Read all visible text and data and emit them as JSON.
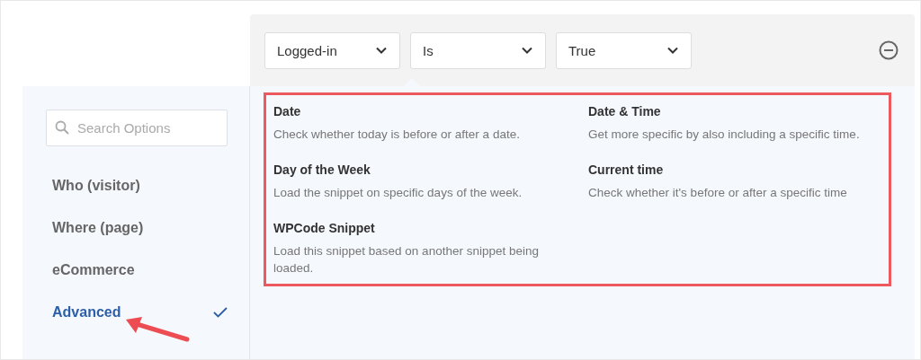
{
  "conditions": [
    {
      "value": "Logged-in"
    },
    {
      "value": "Is"
    },
    {
      "value": "True"
    }
  ],
  "search": {
    "placeholder": "Search Options"
  },
  "categories": [
    {
      "label": "Who (visitor)",
      "selected": false
    },
    {
      "label": "Where (page)",
      "selected": false
    },
    {
      "label": "eCommerce",
      "selected": false
    },
    {
      "label": "Advanced",
      "selected": true
    }
  ],
  "options": [
    {
      "title": "Date",
      "description": "Check whether today is before or after a date."
    },
    {
      "title": "Date & Time",
      "description": "Get more specific by also including a specific time."
    },
    {
      "title": "Day of the Week",
      "description": "Load the snippet on specific days of the week."
    },
    {
      "title": "Current time",
      "description": "Check whether it's before or after a specific time"
    },
    {
      "title": "WPCode Snippet",
      "description": "Load this snippet based on another snippet being loaded."
    }
  ]
}
